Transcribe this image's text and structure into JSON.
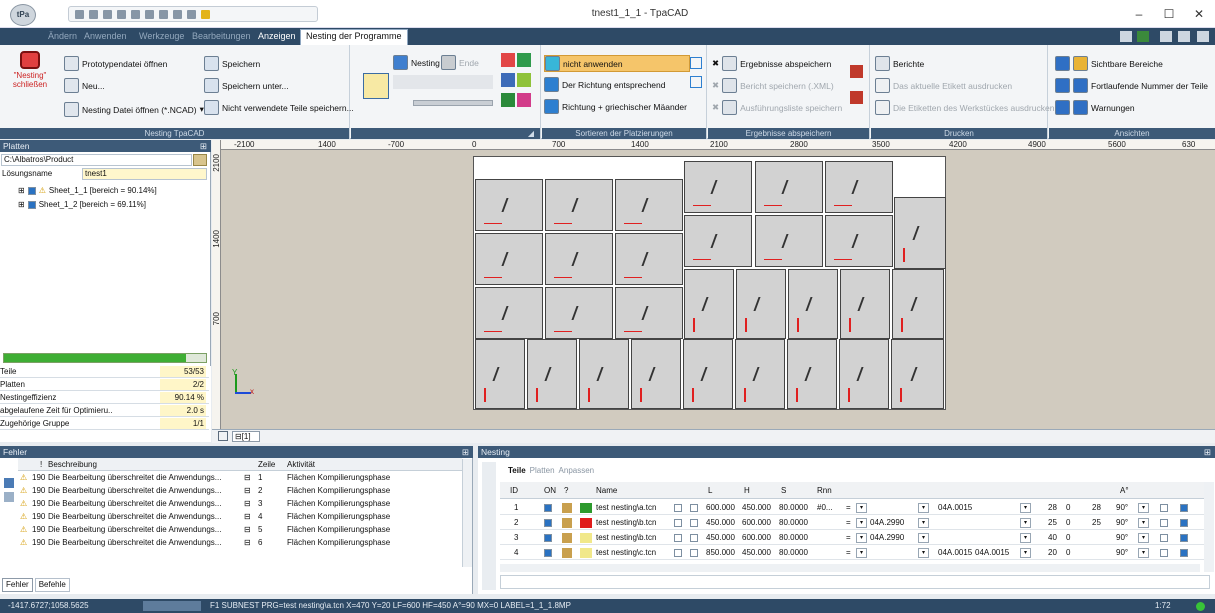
{
  "window": {
    "title": "tnest1_1_1 - TpaCAD",
    "logo": "tPa",
    "controls": {
      "minimize": "–",
      "maximize": "☐",
      "close": "✕"
    }
  },
  "menubar": {
    "items": [
      "Ändern",
      "Anwenden",
      "Werkzeuge",
      "Bearbeitungen",
      "Anzeigen",
      "Nesting der Programme"
    ]
  },
  "ribbon": {
    "groups": {
      "nesting_tpacad": "Nesting TpaCAD",
      "sortieren": "Sortieren der Platzierungen",
      "ergebnisse": "Ergebnisse abspeichern",
      "drucken": "Drucken",
      "ansichten": "Ansichten"
    },
    "close_nesting": "\"Nesting\" schließen",
    "prototype_open": "Prototypendatei öffnen",
    "new": "Neu...",
    "open_ncad": "Nesting Datei öffnen (*.NCAD)",
    "save": "Speichern",
    "save_under": "Speichern unter...",
    "save_unused": "Nicht verwendete Teile speichern...",
    "nesting": "Nesting",
    "end": "Ende",
    "sort_none": "nicht anwenden",
    "sort_direction": "Der Richtung entsprechend",
    "sort_meander": "Richtung + griechischer Mäander",
    "save_results": "Ergebnisse abspeichern",
    "save_report_xml": "Bericht speichern (.XML)",
    "execution_list": "Ausführungsliste speichern",
    "reports": "Berichte",
    "print_label": "Das aktuelle Etikett ausdrucken",
    "print_workpiece_labels": "Die Etiketten des Werkstückes ausdrucken",
    "visible_areas": "Sichtbare Bereiche",
    "serial_number": "Fortlaufende Nummer der Teile",
    "warnings": "Warnungen"
  },
  "left_panel": {
    "title": "Platten",
    "path": "C:\\Albatros\\Product",
    "solution_label": "Lösungsname",
    "solution_value": "tnest1",
    "tree": [
      "Sheet_1_1 [bereich = 90.14%]",
      "Sheet_1_2 [bereich = 69.11%]"
    ],
    "progress": 0.9014,
    "stats": [
      {
        "label": "Teile",
        "value": "53/53"
      },
      {
        "label": "Platten",
        "value": "2/2"
      },
      {
        "label": "Nestingeffizienz",
        "value": "90.14 %"
      },
      {
        "label": "abgelaufene Zeit für Optimieru..",
        "value": "2.0 s"
      },
      {
        "label": "Zugehörige Gruppe",
        "value": "1/1"
      }
    ]
  },
  "canvas": {
    "ruler_h": [
      "-2100",
      "1400",
      "-700",
      "0",
      "700",
      "1400",
      "2100",
      "2800",
      "3500",
      "4200",
      "4900",
      "5600",
      "630"
    ],
    "ruler_v": [
      "2100",
      "1400",
      "700"
    ],
    "sheet_tab": "[1]"
  },
  "errors": {
    "title": "Fehler",
    "headers": {
      "mark": "!",
      "desc": "Beschreibung",
      "line": "Zeile",
      "activity": "Aktivität"
    },
    "rows": [
      {
        "code": "190",
        "desc": "Die Bearbeitung überschreitet die Anwendungs...",
        "line": "1",
        "activity": "Flächen Kompilierungsphase"
      },
      {
        "code": "190",
        "desc": "Die Bearbeitung überschreitet die Anwendungs...",
        "line": "2",
        "activity": "Flächen Kompilierungsphase"
      },
      {
        "code": "190",
        "desc": "Die Bearbeitung überschreitet die Anwendungs...",
        "line": "3",
        "activity": "Flächen Kompilierungsphase"
      },
      {
        "code": "190",
        "desc": "Die Bearbeitung überschreitet die Anwendungs...",
        "line": "4",
        "activity": "Flächen Kompilierungsphase"
      },
      {
        "code": "190",
        "desc": "Die Bearbeitung überschreitet die Anwendungs...",
        "line": "5",
        "activity": "Flächen Kompilierungsphase"
      },
      {
        "code": "190",
        "desc": "Die Bearbeitung überschreitet die Anwendungs...",
        "line": "6",
        "activity": "Flächen Kompilierungsphase"
      }
    ],
    "tabs": [
      "Fehler",
      "Befehle"
    ]
  },
  "nesting_table": {
    "title": "Nesting",
    "tabs": [
      "Teile",
      "Platten",
      "Anpassen"
    ],
    "headers": {
      "id": "ID",
      "on": "ON",
      "q": "?",
      "name": "Name",
      "l": "L",
      "h": "H",
      "s": "S",
      "rnn": "Rnn",
      "a": "A°"
    },
    "rows": [
      {
        "id": "1",
        "name": "test nesting\\a.tcn",
        "color": "#2d9a2d",
        "l": "600.000",
        "h": "450.000",
        "s": "80.0000",
        "rnn": "#0...",
        "eq": "=",
        "c1": "",
        "c2": "04A.0015",
        "n1": "28",
        "n2": "0",
        "n3": "28",
        "ang": "90°"
      },
      {
        "id": "2",
        "name": "test nesting\\b.tcn",
        "color": "#e01b1b",
        "l": "450.000",
        "h": "600.000",
        "s": "80.0000",
        "rnn": "",
        "eq": "=",
        "c1": "04A.2990",
        "c2": "",
        "n1": "25",
        "n2": "0",
        "n3": "25",
        "ang": "90°"
      },
      {
        "id": "3",
        "name": "test nesting\\b.tcn",
        "color": "#f1e88a",
        "l": "450.000",
        "h": "600.000",
        "s": "80.0000",
        "rnn": "",
        "eq": "=",
        "c1": "04A.2990",
        "c2": "",
        "n1": "40",
        "n2": "0",
        "n3": "",
        "ang": "90°"
      },
      {
        "id": "4",
        "name": "test nesting\\c.tcn",
        "color": "#f1e88a",
        "l": "850.000",
        "h": "450.000",
        "s": "80.0000",
        "rnn": "",
        "eq": "=",
        "c1": "",
        "c2": "04A.0015",
        "c3": "04A.0015",
        "n1": "20",
        "n2": "0",
        "n3": "",
        "ang": "90°"
      }
    ]
  },
  "statusbar": {
    "coords": "-1417.6727;1058.5625",
    "info": "F1 SUBNEST PRG=test nesting\\a.tcn X=470 Y=20 LF=600 HF=450 A°=90 MX=0 LABEL=1_1_1.8MP",
    "zoom": "1:72"
  }
}
